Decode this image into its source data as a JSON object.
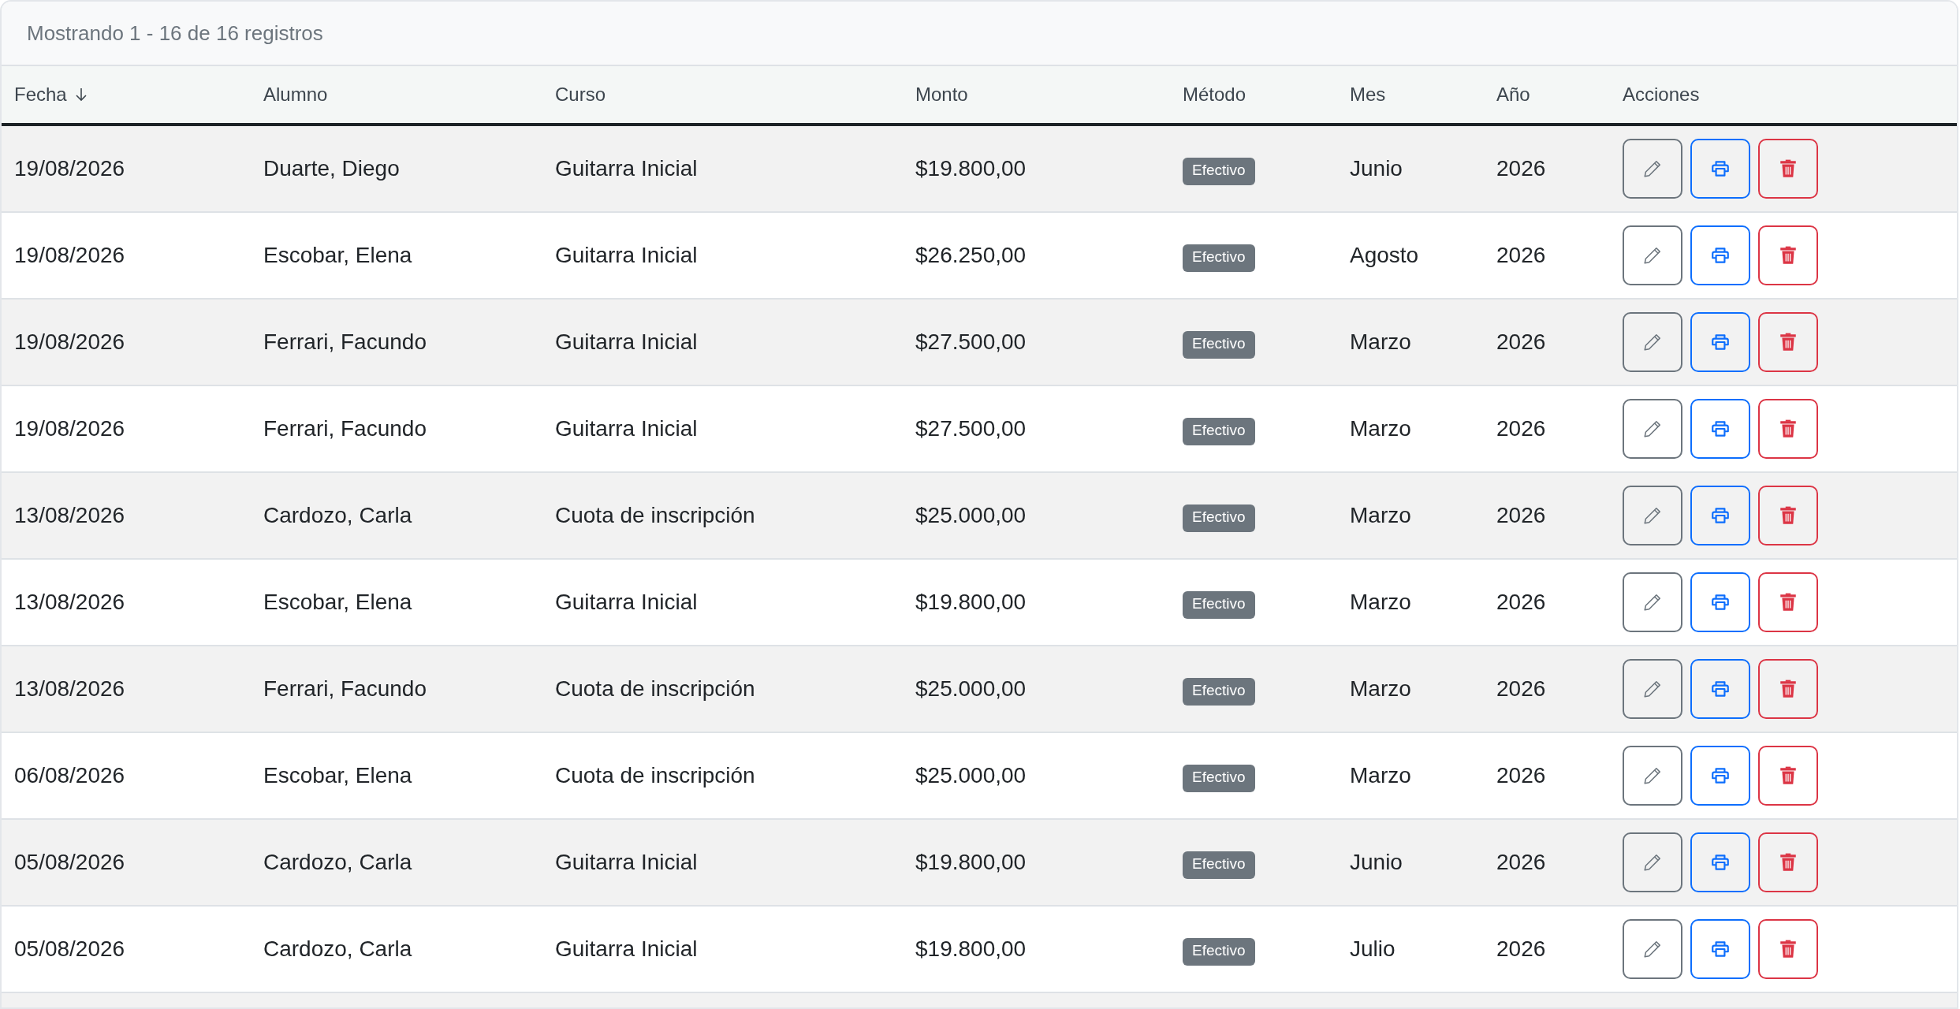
{
  "summary": "Mostrando 1 - 16 de 16 registros",
  "columns": [
    {
      "label": "Fecha",
      "sorted": true
    },
    {
      "label": "Alumno",
      "sorted": false
    },
    {
      "label": "Curso",
      "sorted": false
    },
    {
      "label": "Monto",
      "sorted": false
    },
    {
      "label": "Método",
      "sorted": false
    },
    {
      "label": "Mes",
      "sorted": false
    },
    {
      "label": "Año",
      "sorted": false
    },
    {
      "label": "Acciones",
      "sorted": false
    }
  ],
  "rows": [
    {
      "fecha": "19/08/2026",
      "alumno": "Duarte, Diego",
      "curso": "Guitarra Inicial",
      "monto": "$19.800,00",
      "metodo": "Efectivo",
      "mes": "Junio",
      "anio": "2026"
    },
    {
      "fecha": "19/08/2026",
      "alumno": "Escobar, Elena",
      "curso": "Guitarra Inicial",
      "monto": "$26.250,00",
      "metodo": "Efectivo",
      "mes": "Agosto",
      "anio": "2026"
    },
    {
      "fecha": "19/08/2026",
      "alumno": "Ferrari, Facundo",
      "curso": "Guitarra Inicial",
      "monto": "$27.500,00",
      "metodo": "Efectivo",
      "mes": "Marzo",
      "anio": "2026"
    },
    {
      "fecha": "19/08/2026",
      "alumno": "Ferrari, Facundo",
      "curso": "Guitarra Inicial",
      "monto": "$27.500,00",
      "metodo": "Efectivo",
      "mes": "Marzo",
      "anio": "2026"
    },
    {
      "fecha": "13/08/2026",
      "alumno": "Cardozo, Carla",
      "curso": "Cuota de inscripción",
      "monto": "$25.000,00",
      "metodo": "Efectivo",
      "mes": "Marzo",
      "anio": "2026"
    },
    {
      "fecha": "13/08/2026",
      "alumno": "Escobar, Elena",
      "curso": "Guitarra Inicial",
      "monto": "$19.800,00",
      "metodo": "Efectivo",
      "mes": "Marzo",
      "anio": "2026"
    },
    {
      "fecha": "13/08/2026",
      "alumno": "Ferrari, Facundo",
      "curso": "Cuota de inscripción",
      "monto": "$25.000,00",
      "metodo": "Efectivo",
      "mes": "Marzo",
      "anio": "2026"
    },
    {
      "fecha": "06/08/2026",
      "alumno": "Escobar, Elena",
      "curso": "Cuota de inscripción",
      "monto": "$25.000,00",
      "metodo": "Efectivo",
      "mes": "Marzo",
      "anio": "2026"
    },
    {
      "fecha": "05/08/2026",
      "alumno": "Cardozo, Carla",
      "curso": "Guitarra Inicial",
      "monto": "$19.800,00",
      "metodo": "Efectivo",
      "mes": "Junio",
      "anio": "2026"
    },
    {
      "fecha": "05/08/2026",
      "alumno": "Cardozo, Carla",
      "curso": "Guitarra Inicial",
      "monto": "$19.800,00",
      "metodo": "Efectivo",
      "mes": "Julio",
      "anio": "2026"
    }
  ]
}
